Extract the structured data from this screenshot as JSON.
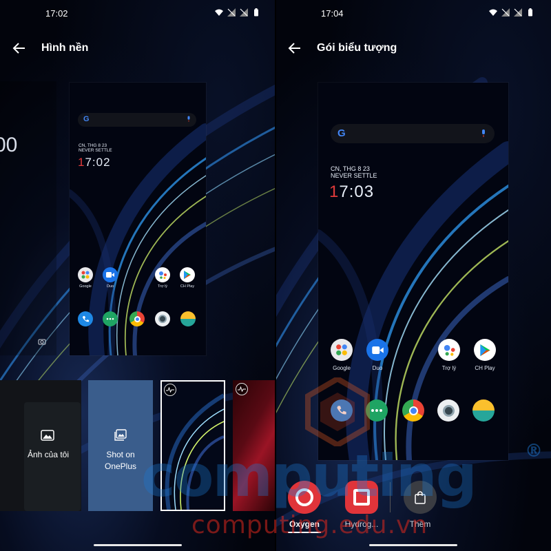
{
  "left_screen": {
    "status": {
      "time": "17:02"
    },
    "app_bar": {
      "title": "Hình nền"
    },
    "preview": {
      "date_line1": "CN, THG 8 23",
      "date_line2": "NEVER SETTLE",
      "clock_lead": "1",
      "clock_rest": "7:02",
      "apps_row1": [
        {
          "label": "Google",
          "icon": "google-folder-icon"
        },
        {
          "label": "Duo",
          "icon": "duo-icon"
        },
        {
          "label": "",
          "icon": ""
        },
        {
          "label": "Trợ lý",
          "icon": "assistant-icon"
        },
        {
          "label": "CH Play",
          "icon": "play-store-icon"
        }
      ],
      "dock": [
        "phone-icon",
        "messages-icon",
        "chrome-icon",
        "camera-icon",
        "weather-icon"
      ]
    },
    "side_clock": "00",
    "thumbnails": [
      {
        "label": "Ảnh của tôi",
        "icon": "photo-icon"
      },
      {
        "label": "Shot on OnePlus",
        "icon": "gallery-icon"
      },
      {
        "label": "",
        "icon": "live-wallpaper-icon",
        "selected": true
      },
      {
        "label": "",
        "icon": "live-wallpaper-icon"
      }
    ]
  },
  "right_screen": {
    "status": {
      "time": "17:04"
    },
    "app_bar": {
      "title": "Gói biểu tượng"
    },
    "preview": {
      "date_line1": "CN, THG 8 23",
      "date_line2": "NEVER SETTLE",
      "clock_lead": "1",
      "clock_rest": "7:03",
      "apps_row1": [
        {
          "label": "Google",
          "icon": "google-folder-icon"
        },
        {
          "label": "Duo",
          "icon": "duo-icon"
        },
        {
          "label": "",
          "icon": ""
        },
        {
          "label": "Trợ lý",
          "icon": "assistant-icon"
        },
        {
          "label": "CH Play",
          "icon": "play-store-icon"
        }
      ],
      "dock": [
        "phone-icon",
        "messages-icon",
        "chrome-icon",
        "camera-icon",
        "weather-icon"
      ]
    },
    "icon_packs": [
      {
        "label": "Oxygen",
        "icon": "oxygen-round-icon",
        "selected": true
      },
      {
        "label": "Hydrog...",
        "icon": "hydrogen-square-icon"
      },
      {
        "label": "Thêm",
        "icon": "shopping-bag-icon"
      }
    ]
  },
  "watermark": {
    "logo_text": "computing",
    "url_text": "computing.edu.vn",
    "registered": "®"
  },
  "colors": {
    "accent_red": "#e23b3b",
    "duo_blue": "#1a73e8",
    "phone_blue": "#1e88e5",
    "messages_green": "#1fa463",
    "selected_card_border": "#ffffff",
    "shot_on_card": "#3a5d8c"
  }
}
